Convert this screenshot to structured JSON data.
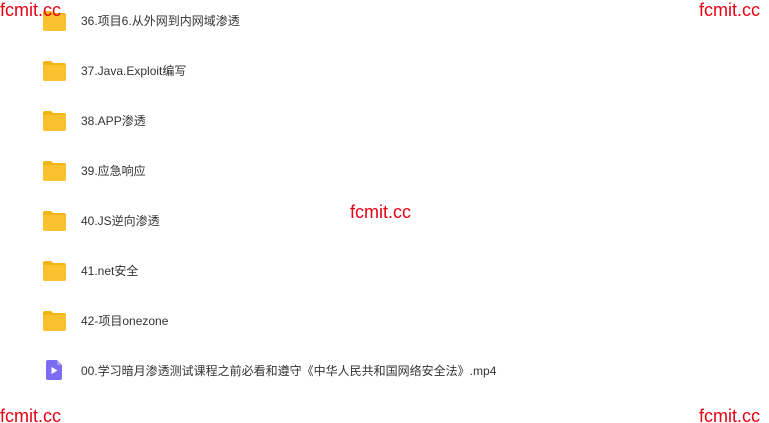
{
  "files": [
    {
      "name": "36.项目6.从外网到内网域渗透",
      "type": "folder"
    },
    {
      "name": "37.Java.Exploit编写",
      "type": "folder"
    },
    {
      "name": "38.APP渗透",
      "type": "folder"
    },
    {
      "name": "39.应急响应",
      "type": "folder"
    },
    {
      "name": "40.JS逆向渗透",
      "type": "folder"
    },
    {
      "name": "41.net安全",
      "type": "folder"
    },
    {
      "name": "42-项目onezone",
      "type": "folder"
    },
    {
      "name": "00.学习暗月渗透测试课程之前必看和遵守《中华人民共和国网络安全法》.mp4",
      "type": "video"
    }
  ],
  "watermarks": {
    "top_left": "fcmit.cc",
    "top_right": "fcmit.cc",
    "center": "fcmit.cc",
    "bottom_left": "fcmit.cc",
    "bottom_right": "fcmit.cc"
  },
  "colors": {
    "folder": "#f9c22e",
    "folder_tab": "#f2b516",
    "video": "#7c6cf2",
    "watermark": "#e60012",
    "text": "#333333"
  },
  "icons": {
    "folder": "folder-icon",
    "video": "video-file-icon"
  }
}
